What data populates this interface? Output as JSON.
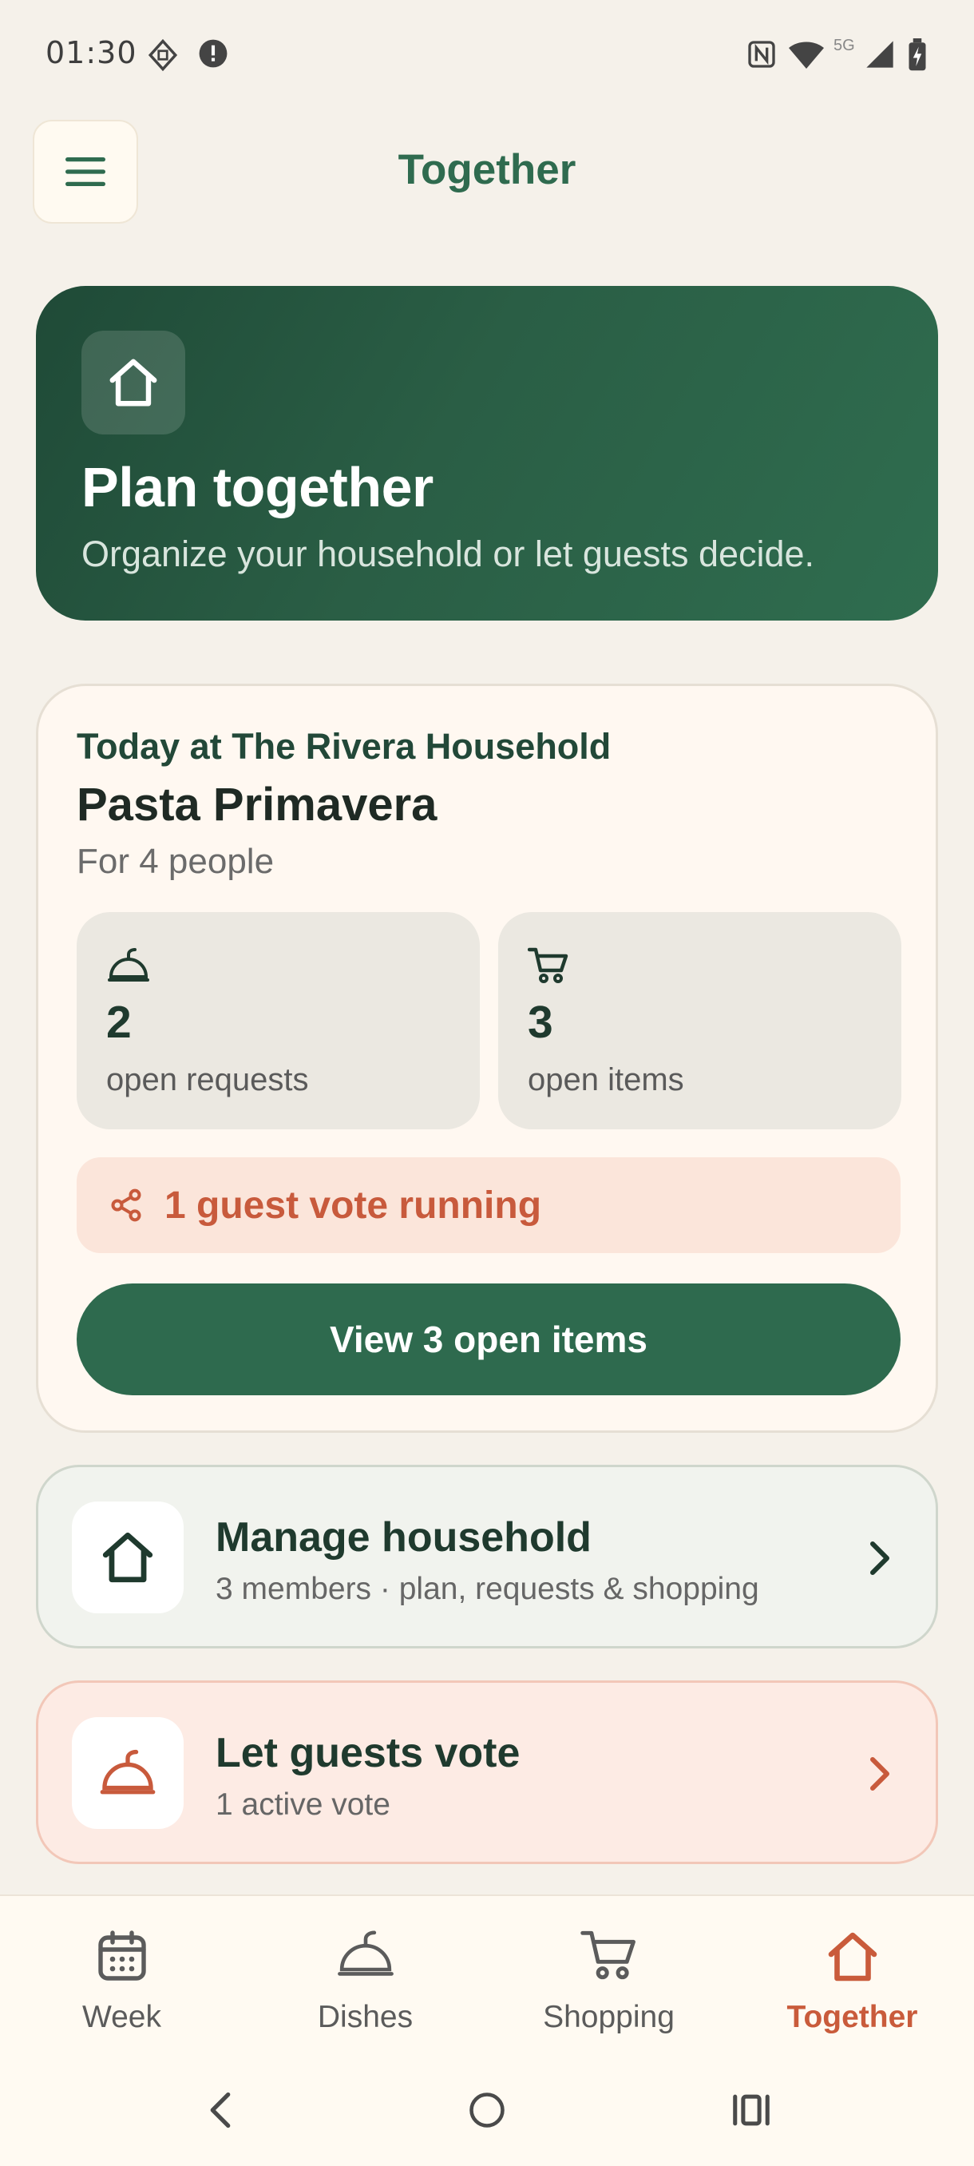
{
  "status_bar": {
    "time": "01:30",
    "network": "5G"
  },
  "top_bar": {
    "title": "Together"
  },
  "hero": {
    "title": "Plan together",
    "subtitle": "Organize your household or let guests decide."
  },
  "today": {
    "location": "Today at The Rivera Household",
    "dish": "Pasta Primavera",
    "people": "For 4 people",
    "stats": [
      {
        "icon": "cloche-icon",
        "value": "2",
        "label": "open requests"
      },
      {
        "icon": "cart-icon",
        "value": "3",
        "label": "open items"
      }
    ],
    "vote_banner": "1 guest vote running",
    "view_button": "View 3 open items"
  },
  "actions": {
    "manage": {
      "title": "Manage household",
      "subtitle": "3 members · plan, requests & shopping"
    },
    "guests": {
      "title": "Let guests vote",
      "subtitle": "1 active vote"
    }
  },
  "bottom_nav": [
    {
      "label": "Week",
      "icon": "calendar-icon",
      "active": false
    },
    {
      "label": "Dishes",
      "icon": "cloche-icon",
      "active": false
    },
    {
      "label": "Shopping",
      "icon": "cart-icon",
      "active": false
    },
    {
      "label": "Together",
      "icon": "house-icon",
      "active": true
    }
  ],
  "colors": {
    "primary": "#2e6a4e",
    "accent": "#c95b3b",
    "background": "#f5f1ea"
  }
}
